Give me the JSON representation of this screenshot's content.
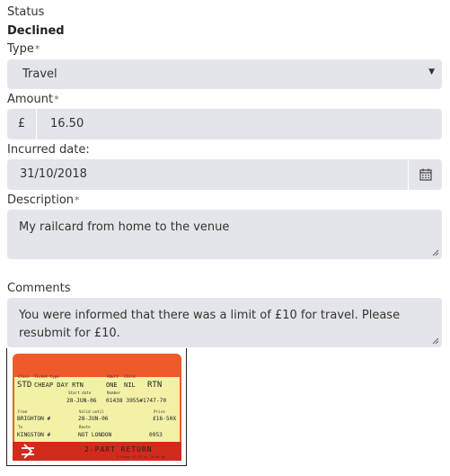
{
  "status": {
    "label": "Status",
    "value": "Declined"
  },
  "type": {
    "label": "Type",
    "required": "*",
    "value": "Travel"
  },
  "amount": {
    "label": "Amount",
    "required": "*",
    "currency": "£",
    "value": "16.50"
  },
  "incurred_date": {
    "label": "Incurred date:",
    "value": "31/10/2018"
  },
  "description": {
    "label": "Description",
    "required": "*",
    "value": "My railcard from home to the venue"
  },
  "comments": {
    "label": "Comments",
    "value": "You were informed that there was a limit of £10 for travel. Please resubmit for £10."
  },
  "ticket": {
    "class_label": "Class",
    "class_value": "STD",
    "ticket_type_label": "Ticket type",
    "ticket_type_value": "CHEAP DAY RTN",
    "adult_label": "Adult",
    "adult_value": "ONE",
    "child_label": "Child",
    "child_value": "NIL",
    "rtn": "RTN",
    "start_date_label": "Start date",
    "start_date_value": "28-JUN-06",
    "number_label": "Number",
    "number_value": "01438  3955#1747-70",
    "from_label": "From",
    "from_value": "BRIGHTON #",
    "valid_until_label": "Valid until",
    "valid_until_value": "28-JUN-06",
    "price_label": "Price",
    "price_value": "£16·50X",
    "to_label": "To",
    "to_value": "KINGSTON #",
    "route_label": "Route",
    "route_value": "NOT LONDON",
    "code_value": "0953",
    "banner": "2-PART  RETURN",
    "footer": "P-issue 07:53 on 28.06.06"
  },
  "colors": {
    "field_bg": "#e4e5ea",
    "ticket_orange": "#ee5a2a",
    "ticket_red": "#d42a1c",
    "ticket_yellow": "#f2f1a6"
  }
}
